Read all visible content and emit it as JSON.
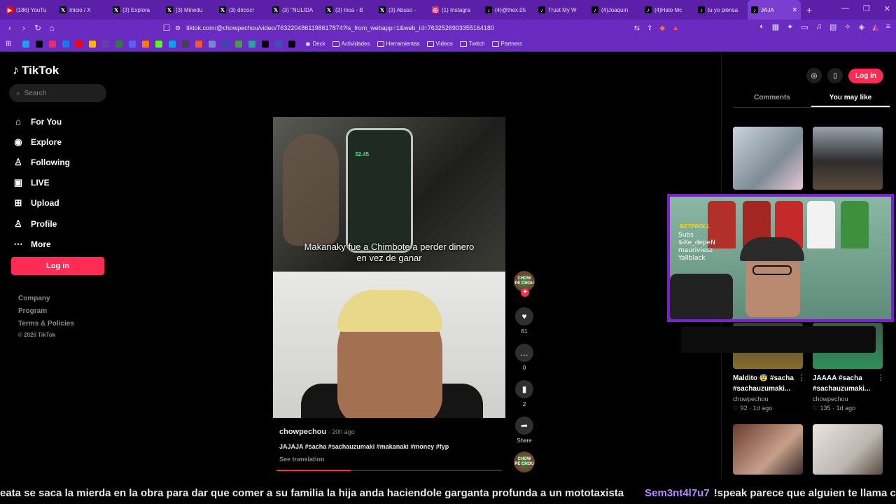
{
  "browser": {
    "tabs": [
      {
        "title": "(186) YouTu",
        "icon": "youtube-icon",
        "color": "#ff0000",
        "glyph": "▶"
      },
      {
        "title": "Inicio / X",
        "icon": "x-icon",
        "color": "#000000",
        "glyph": "𝕏"
      },
      {
        "title": "(3) Explora",
        "icon": "x-icon",
        "color": "#000000",
        "glyph": "𝕏"
      },
      {
        "title": "(3) Minedu",
        "icon": "x-icon",
        "color": "#000000",
        "glyph": "𝕏"
      },
      {
        "title": "(3) dircocr",
        "icon": "x-icon",
        "color": "#000000",
        "glyph": "𝕏"
      },
      {
        "title": "(3) \"NULIDA",
        "icon": "x-icon",
        "color": "#000000",
        "glyph": "𝕏"
      },
      {
        "title": "(3) Inca - B",
        "icon": "x-icon",
        "color": "#000000",
        "glyph": "𝕏"
      },
      {
        "title": "(3) Abuso -",
        "icon": "x-icon",
        "color": "#000000",
        "glyph": "𝕏"
      },
      {
        "title": "(1) Instagra",
        "icon": "instagram-icon",
        "color": "#e1306c",
        "glyph": "◎"
      },
      {
        "title": "(4)@thex.05",
        "icon": "tiktok-icon",
        "color": "#000000",
        "glyph": "♪"
      },
      {
        "title": "Trust My W",
        "icon": "tiktok-icon",
        "color": "#000000",
        "glyph": "♪"
      },
      {
        "title": "(4)Joaquín",
        "icon": "tiktok-icon",
        "color": "#000000",
        "glyph": "♪"
      },
      {
        "title": "(4)Halo Mc",
        "icon": "tiktok-icon",
        "color": "#000000",
        "glyph": "♪"
      },
      {
        "title": "tu yo piénsa",
        "icon": "tiktok-icon",
        "color": "#000000",
        "glyph": "♪"
      },
      {
        "title": "JAJA",
        "icon": "tiktok-icon",
        "color": "#000000",
        "glyph": "♪",
        "active": true
      }
    ],
    "url": "tiktok.com/@chowpechou/video/7632204861198617874?is_from_webapp=1&web_id=7632526903355164180",
    "bookmarks": [
      {
        "color": "#1da1f2"
      },
      {
        "color": "#000000"
      },
      {
        "color": "#e1306c"
      },
      {
        "color": "#1877f2"
      },
      {
        "color": "#ff0000"
      },
      {
        "color": "#ffb300"
      },
      {
        "color": "#6441a5"
      },
      {
        "color": "#2e7d32"
      },
      {
        "color": "#5865f2"
      },
      {
        "color": "#ff7a00"
      },
      {
        "color": "#53fc18"
      },
      {
        "color": "#00a8e8"
      },
      {
        "color": "#444444"
      },
      {
        "color": "#ff5722"
      },
      {
        "color": "#7986cb"
      },
      {
        "color": "#3949ab"
      },
      {
        "color": "#43a047"
      },
      {
        "color": "#26a69a"
      },
      {
        "color": "#000000"
      },
      {
        "color": "#3f51b5"
      },
      {
        "color": "#000000"
      }
    ],
    "bookmark_folders": [
      "Deck",
      "Actividades",
      "Herramientas",
      "Videos",
      "Twitch",
      "Partners"
    ]
  },
  "sidebar": {
    "logo": "TikTok",
    "search_placeholder": "Search",
    "nav": [
      {
        "label": "For You",
        "icon": "home-icon",
        "glyph": "⌂"
      },
      {
        "label": "Explore",
        "icon": "compass-icon",
        "glyph": "◉"
      },
      {
        "label": "Following",
        "icon": "following-icon",
        "glyph": "♙"
      },
      {
        "label": "LIVE",
        "icon": "live-icon",
        "glyph": "▣"
      },
      {
        "label": "Upload",
        "icon": "upload-icon",
        "glyph": "⊞"
      },
      {
        "label": "Profile",
        "icon": "profile-icon",
        "glyph": "♙"
      },
      {
        "label": "More",
        "icon": "more-icon",
        "glyph": "⋯"
      }
    ],
    "login": "Log in",
    "footer": [
      "Company",
      "Program",
      "Terms & Policies"
    ],
    "copyright": "© 2026 TikTok"
  },
  "video": {
    "caption_line1": "Makanaky fue a Chimbote a perder dinero",
    "caption_line2": "en vez de ganar",
    "phone_amount": "32.45",
    "author": "chowpechou",
    "time": " · 20h ago",
    "description": "JAJAJA #sacha #sachauzumaki #makanaki #money #fyp",
    "see_translation": "See translation",
    "progress": 0.33,
    "avatar_text": "CHOW PE CHOU",
    "likes": "61",
    "comments": "0",
    "saves": "2",
    "share": "Share"
  },
  "right_panel": {
    "login": "Log in",
    "tabs": [
      "Comments",
      "You may like"
    ],
    "cards": [
      {
        "title": "Maldito 😨 #sacha",
        "title2": "#sachauzumaki...",
        "author": "chowpechou",
        "likes": "♡ 92",
        "age": " · 1d ago"
      },
      {
        "title": "JAAAA #sacha",
        "title2": "#sachauzumaki...",
        "author": "chowpechou",
        "likes": "♡ 135",
        "age": " · 1d ago"
      }
    ]
  },
  "cam": {
    "logo": "BETPROLL",
    "lines": [
      "Subs",
      "$iKe_depeN",
      "mauriviesz",
      "Yallblack"
    ]
  },
  "ticker": {
    "message": "eata se saca la mierda en la obra para dar que comer a su familia la hija anda haciendole garganta profunda a un mototaxista",
    "user": "Sem3nt4l7u7",
    "message2": "!speak parece que alguien te llama cholito"
  }
}
